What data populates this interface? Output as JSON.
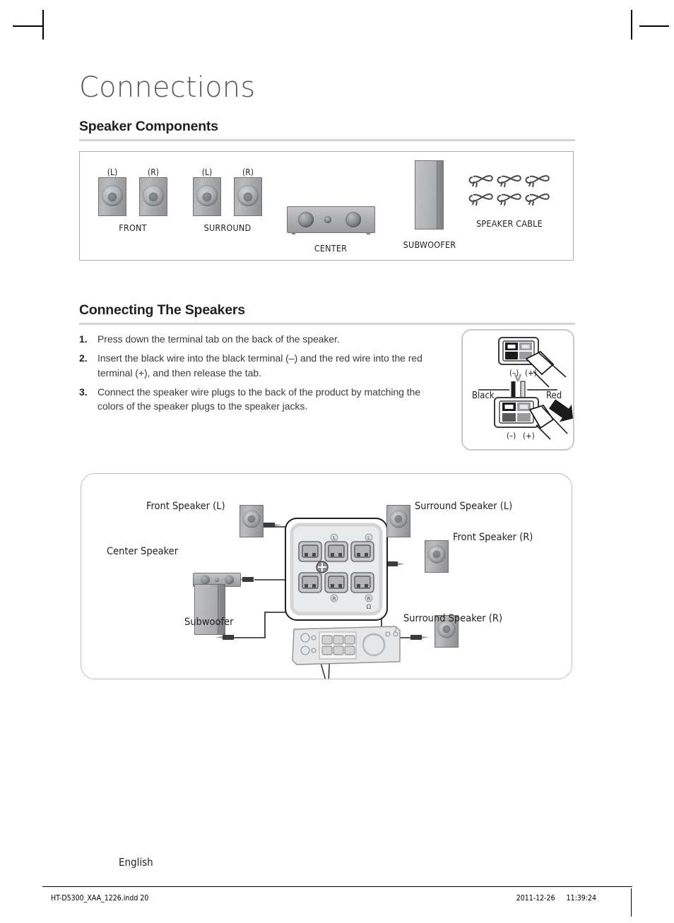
{
  "page": {
    "chapter_title": "Connections",
    "language": "English",
    "footer_file": "HT-D5300_XAA_1226.indd   20",
    "footer_date": "2011-12-26",
    "footer_time": "11:39:24",
    "rule_color": "#d2d3d5",
    "text_color": "#231f20"
  },
  "sections": {
    "components": {
      "title": "Speaker Components"
    },
    "connecting": {
      "title": "Connecting The Speakers"
    }
  },
  "components": {
    "items": [
      {
        "name": "FRONT",
        "channels": [
          "(L)",
          "(R)"
        ],
        "icon": "satellite-speaker"
      },
      {
        "name": "SURROUND",
        "channels": [
          "(L)",
          "(R)"
        ],
        "icon": "satellite-speaker"
      },
      {
        "name": "CENTER",
        "channels": [],
        "icon": "center-speaker"
      },
      {
        "name": "SUBWOOFER",
        "channels": [],
        "icon": "subwoofer"
      },
      {
        "name": "SPEAKER CABLE",
        "channels": [],
        "icon": "speaker-cable",
        "count": 6
      }
    ]
  },
  "steps": [
    {
      "num": "1.",
      "text": "Press down the terminal tab on the back of the speaker."
    },
    {
      "num": "2.",
      "text": "Insert the black wire into the black terminal (–) and the red wire into the red terminal (+), and then release the tab."
    },
    {
      "num": "3.",
      "text": "Connect the speaker wire plugs to the back of the product by matching the colors of the speaker plugs to the speaker jacks."
    }
  ],
  "terminal_detail": {
    "top_minus": "(–)",
    "top_plus": "(+)",
    "bottom_minus": "(–)",
    "bottom_plus": "(+)",
    "black_label": "Black",
    "red_label": "Red"
  },
  "diagram": {
    "labels": {
      "front_l": "Front Speaker (L)",
      "front_r": "Front Speaker (R)",
      "surround_l": "Surround Speaker (L)",
      "surround_r": "Surround Speaker (R)",
      "center": "Center Speaker",
      "subwoofer": "Subwoofer"
    },
    "jack_marks": {
      "top_left_l": "L",
      "top_right_l": "L",
      "bottom_left_r": "R",
      "bottom_right_r": "R",
      "sub_mark": "Ω"
    }
  }
}
